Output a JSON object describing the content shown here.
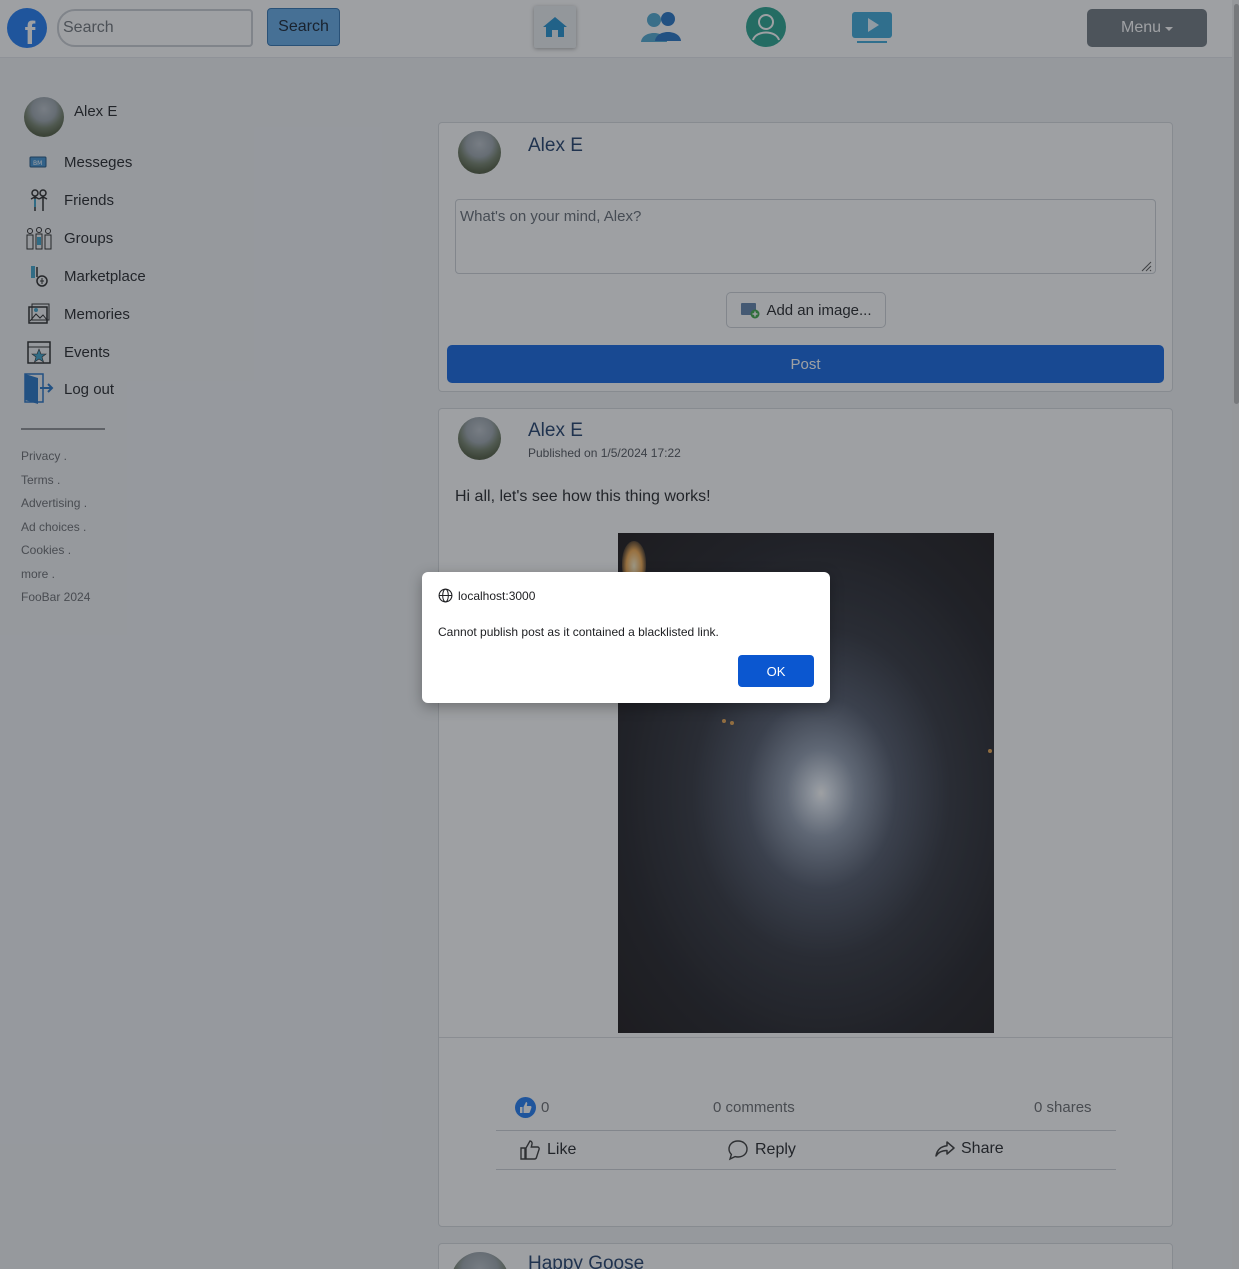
{
  "header": {
    "logo_letter": "f",
    "search_placeholder": "Search",
    "search_button": "Search",
    "nav_icons": [
      "home-icon",
      "friends-icon",
      "profile-icon",
      "watch-icon"
    ],
    "menu_label": "Menu"
  },
  "sidebar": {
    "user_name": "Alex E",
    "items": [
      {
        "label": "Messeges",
        "icon": "messages-icon"
      },
      {
        "label": "Friends",
        "icon": "friends-icon"
      },
      {
        "label": "Groups",
        "icon": "groups-icon"
      },
      {
        "label": "Marketplace",
        "icon": "marketplace-icon"
      },
      {
        "label": "Memories",
        "icon": "memories-icon"
      },
      {
        "label": "Events",
        "icon": "events-icon"
      },
      {
        "label": "Log out",
        "icon": "logout-icon"
      }
    ],
    "footer": [
      "Privacy .",
      "Terms .",
      "Advertising .",
      "Ad choices .",
      "Cookies .",
      "more .",
      "FooBar 2024"
    ]
  },
  "composer": {
    "author": "Alex E",
    "placeholder": "What's on your mind, Alex?",
    "add_image": "Add an image...",
    "post_button": "Post"
  },
  "post": {
    "author": "Alex E",
    "published": "Published on 1/5/2024 17:22",
    "text": "Hi all, let's see how this thing works!",
    "likes": "0",
    "comments": "0 comments",
    "shares": "0 shares",
    "actions": {
      "like": "Like",
      "reply": "Reply",
      "share": "Share"
    }
  },
  "next_post": {
    "author": "Happy Goose"
  },
  "dialog": {
    "origin": "localhost:3000",
    "message": "Cannot publish post as it contained a blacklisted link.",
    "ok": "OK"
  },
  "colors": {
    "brand": "#1877f2",
    "post_button": "#0b62e0",
    "dialog_ok": "#0b57d0",
    "menu_button": "#6c757d"
  }
}
